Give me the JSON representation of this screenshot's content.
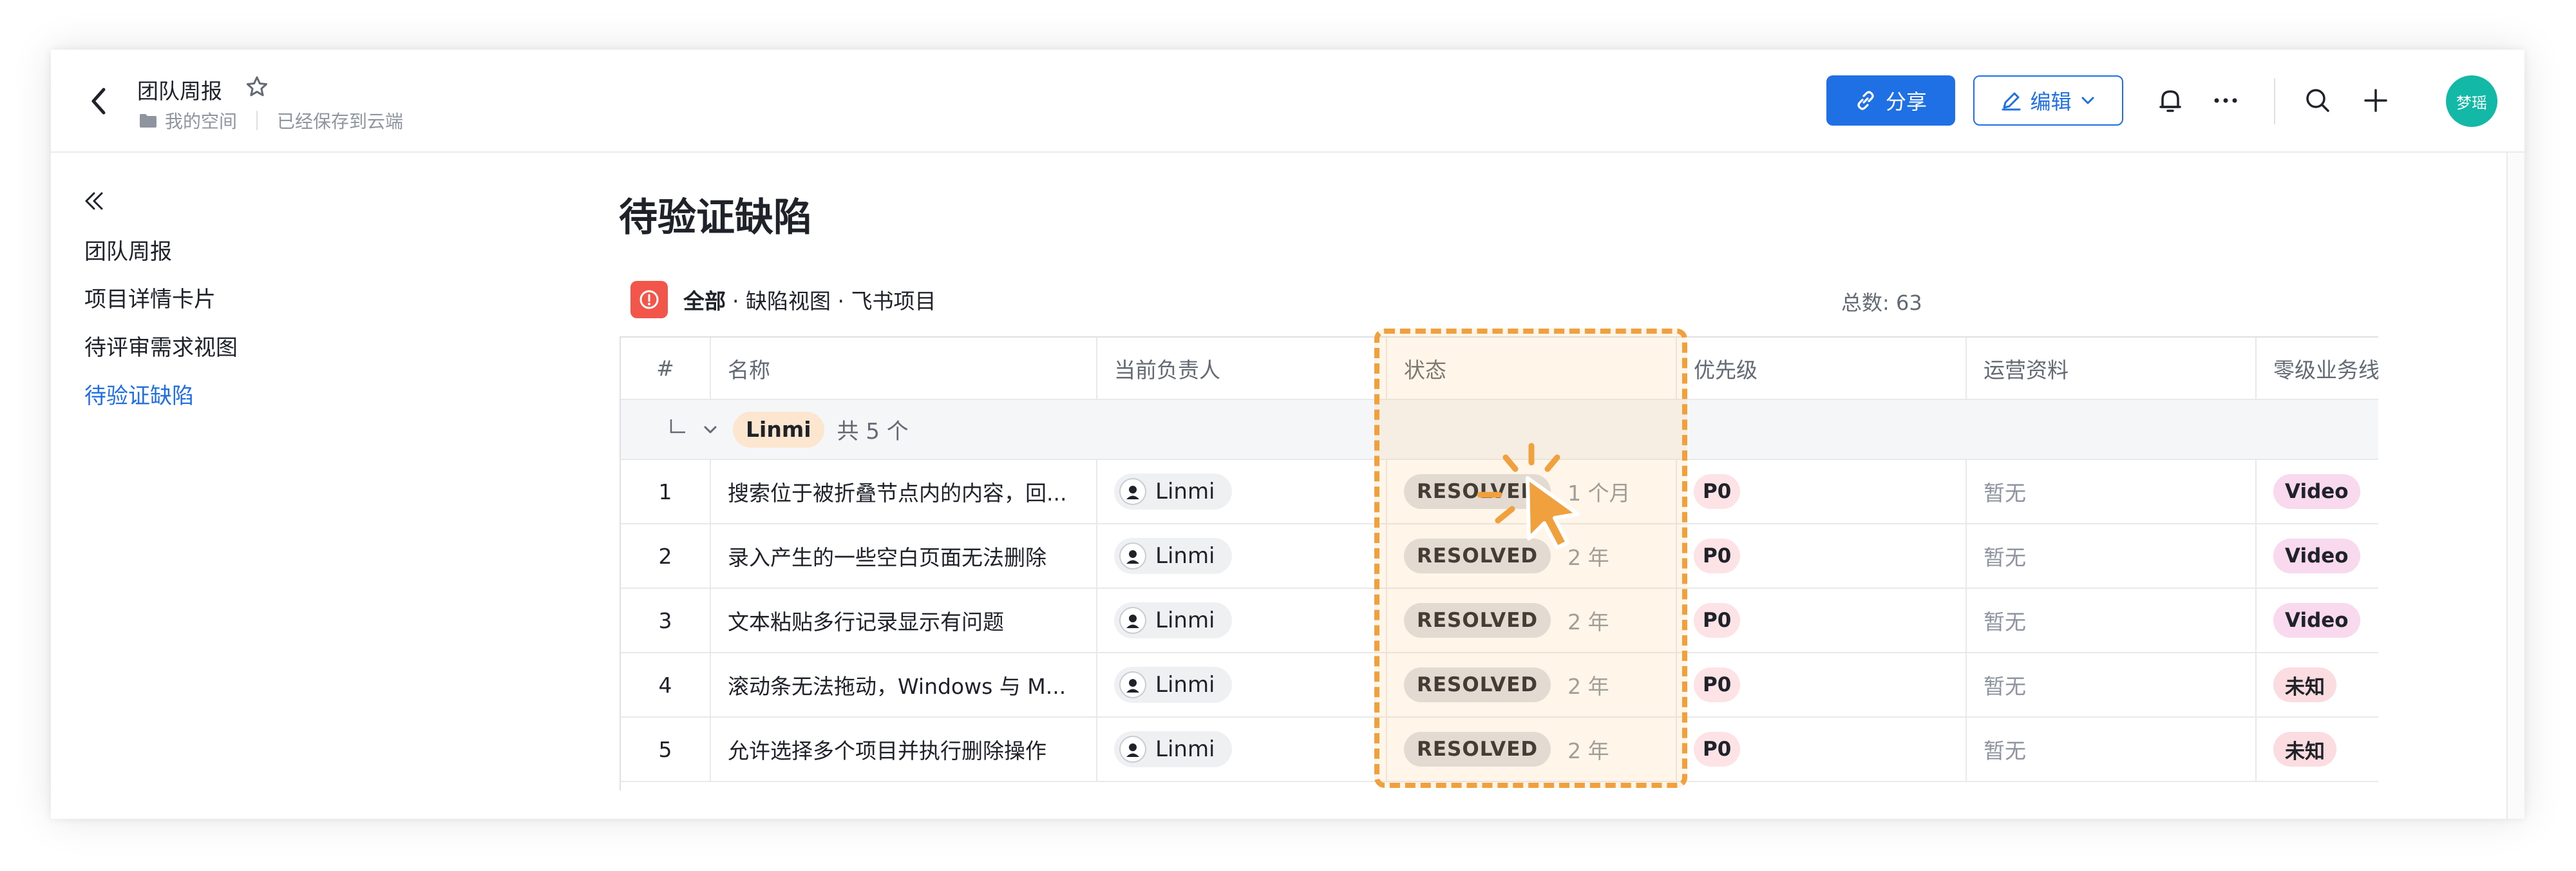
{
  "header": {
    "doc_title": "团队周报",
    "location": "我的空间",
    "save_status": "已经保存到云端",
    "share_label": "分享",
    "edit_label": "编辑",
    "user_avatar_text": "梦瑶"
  },
  "sidebar": {
    "items": [
      {
        "label": "团队周报"
      },
      {
        "label": "项目详情卡片"
      },
      {
        "label": "待评审需求视图"
      },
      {
        "label": "待验证缺陷"
      }
    ]
  },
  "main": {
    "title": "待验证缺陷",
    "view_all": "全部",
    "view_path": "· 缺陷视图 · 飞书项目",
    "total": "总数: 63"
  },
  "table": {
    "columns": [
      "#",
      "名称",
      "当前负责人",
      "状态",
      "优先级",
      "运营资料",
      "零级业务线"
    ],
    "group": {
      "owner": "Linmi",
      "count_text": "共 5 个"
    },
    "rows": [
      {
        "num": "1",
        "name": "搜索位于被折叠节点内的内容，回...",
        "owner": "Linmi",
        "status": "RESOLVED",
        "time": "1 个月",
        "priority": "P0",
        "ops": "暂无",
        "biz": "Video"
      },
      {
        "num": "2",
        "name": "录入产生的一些空白页面无法删除",
        "owner": "Linmi",
        "status": "RESOLVED",
        "time": "2 年",
        "priority": "P0",
        "ops": "暂无",
        "biz": "Video"
      },
      {
        "num": "3",
        "name": "文本粘贴多行记录显示有问题",
        "owner": "Linmi",
        "status": "RESOLVED",
        "time": "2 年",
        "priority": "P0",
        "ops": "暂无",
        "biz": "Video"
      },
      {
        "num": "4",
        "name": "滚动条无法拖动，Windows 与 M...",
        "owner": "Linmi",
        "status": "RESOLVED",
        "time": "2 年",
        "priority": "P0",
        "ops": "暂无",
        "biz": "未知"
      },
      {
        "num": "5",
        "name": "允许选择多个项目并执行删除操作",
        "owner": "Linmi",
        "status": "RESOLVED",
        "time": "2 年",
        "priority": "P0",
        "ops": "暂无",
        "biz": "未知"
      }
    ]
  },
  "colors": {
    "accent": "#1f6fe5",
    "highlight": "#f0a03c",
    "view_icon": "#f2564a",
    "avatar": "#14b8a6"
  },
  "icons": [
    "back-arrow-icon",
    "star-icon",
    "folder-icon",
    "link-icon",
    "pencil-icon",
    "chevron-down-icon",
    "bell-icon",
    "more-icon",
    "search-icon",
    "plus-icon",
    "collapse-icon",
    "info-icon",
    "cursor-click-icon"
  ]
}
